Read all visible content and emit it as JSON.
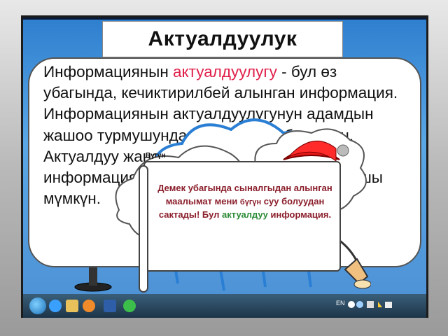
{
  "slide": {
    "title": "Актуалдуулук",
    "paragraph": {
      "part1": "Информациянын ",
      "accent_word": "актуалдуулугу",
      "part2": " - бул  өз убагында, кечиктирилбей алынган информация. Информациянын актуалдуулугунун адамдын жашоо турмушундагы мааниси абдан чоң. Актуалдуу жана өз убагында алынган информация адамдын өмүрүн сактап калышы мүмкүн."
    },
    "callout": {
      "cloud_caption": "Бүгүн",
      "part1": "Демек убагында сыналгыдан алынган маалымат мени ",
      "bugun": "бүгүн",
      "part2": " суу болуудан сактады! Бул ",
      "green_word": "актуалдуу",
      "part3": " информация."
    }
  },
  "taskbar": {
    "language": "EN"
  },
  "colors": {
    "accent": "#e0204a",
    "green": "#2a8a35",
    "callout_text": "#8a1d2a",
    "rain": "#2a7fd4"
  }
}
